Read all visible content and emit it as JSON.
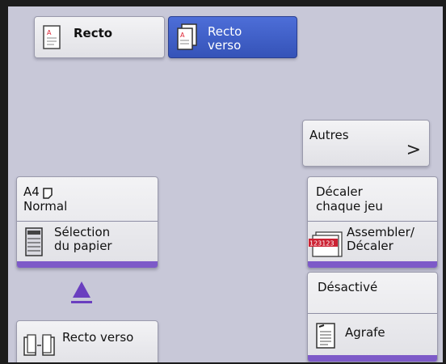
{
  "sides": {
    "recto_label": "Recto",
    "recto_verso_line1": "Recto",
    "recto_verso_line2": "verso"
  },
  "others": {
    "label": "Autres",
    "chevron": ">"
  },
  "paper": {
    "size": "A4",
    "type": "Normal",
    "action_line1": "Sélection",
    "action_line2": "du papier"
  },
  "offset": {
    "value_line1": "Décaler",
    "value_line2": "chaque jeu",
    "action_line1": "Assembler/",
    "action_line2": "Décaler",
    "icon_text": "123123"
  },
  "duplex": {
    "label": "Recto verso"
  },
  "staple": {
    "value": "Désactivé",
    "action": "Agrafe"
  },
  "icons": {
    "recto": "single-page-icon",
    "recto_verso": "double-page-icon",
    "portrait": "portrait-page-icon",
    "tray": "paper-tray-icon",
    "collate": "collate-offset-icon",
    "duplex": "duplex-copy-icon",
    "staple": "staple-document-icon",
    "arrow": "up-arrow-icon"
  },
  "colors": {
    "screen_bg": "#c8c8d8",
    "selected_bg": "#3f5fc6",
    "accent_bar": "#7d5ac8"
  }
}
